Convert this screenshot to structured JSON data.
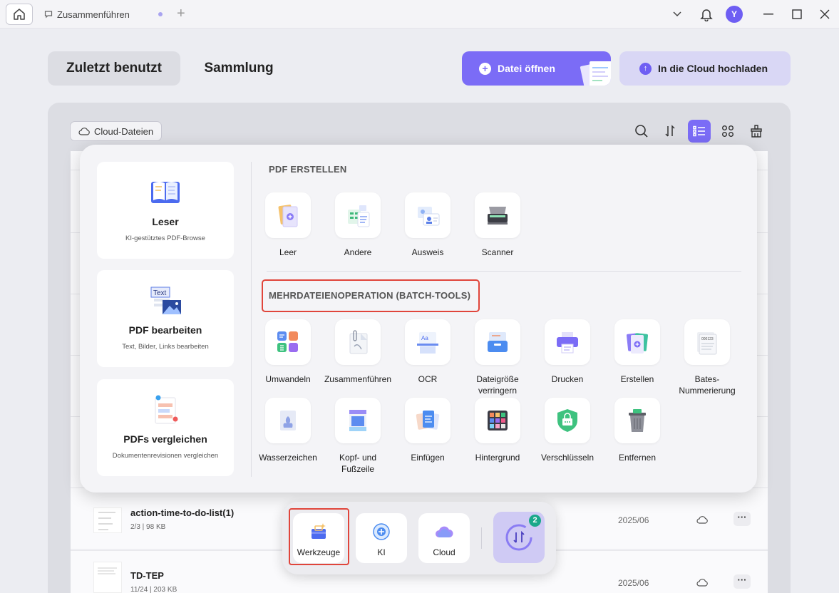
{
  "titlebar": {
    "tab_title": "Zusammenführen",
    "avatar_letter": "Y"
  },
  "nav": {
    "recent": "Zuletzt benutzt",
    "collection": "Sammlung",
    "open_file": "Datei öffnen",
    "upload_cloud": "In die Cloud hochladen"
  },
  "toolbar": {
    "cloud_files": "Cloud-Dateien"
  },
  "popover": {
    "cards": [
      {
        "title": "Leser",
        "subtitle": "KI-gestütztes PDF-Browse",
        "icon": "book-icon"
      },
      {
        "title": "PDF bearbeiten",
        "subtitle": "Text, Bilder, Links bearbeiten",
        "icon": "edit-text-icon"
      },
      {
        "title": "PDFs vergleichen",
        "subtitle": "Dokumentenrevisionen vergleichen",
        "icon": "compare-icon"
      }
    ],
    "create_title": "PDF ERSTELLEN",
    "create_items": [
      {
        "label": "Leer",
        "icon": "blank-page-icon"
      },
      {
        "label": "Andere",
        "icon": "other-formats-icon"
      },
      {
        "label": "Ausweis",
        "icon": "id-card-icon"
      },
      {
        "label": "Scanner",
        "icon": "scanner-icon"
      }
    ],
    "batch_title": "MEHRDATEIENOPERATION (BATCH-TOOLS)",
    "batch_row1": [
      {
        "label": "Umwandeln",
        "icon": "convert-icon"
      },
      {
        "label": "Zusammenführen",
        "icon": "merge-icon"
      },
      {
        "label": "OCR",
        "icon": "ocr-icon"
      },
      {
        "label": "Dateigröße verringern",
        "icon": "compress-icon"
      },
      {
        "label": "Drucken",
        "icon": "print-icon"
      },
      {
        "label": "Erstellen",
        "icon": "create-icon"
      },
      {
        "label": "Bates-Nummerierung",
        "icon": "bates-icon"
      }
    ],
    "batch_row2": [
      {
        "label": "Wasserzeichen",
        "icon": "watermark-icon"
      },
      {
        "label": "Kopf- und Fußzeile",
        "icon": "header-footer-icon"
      },
      {
        "label": "Einfügen",
        "icon": "insert-icon"
      },
      {
        "label": "Hintergrund",
        "icon": "background-icon"
      },
      {
        "label": "Verschlüsseln",
        "icon": "encrypt-icon"
      },
      {
        "label": "Entfernen",
        "icon": "remove-icon"
      }
    ]
  },
  "files": [
    {
      "name": "action-time-to-do-list(1)",
      "meta": "2/3 | 98 KB",
      "date": "2025/06"
    },
    {
      "name": "TD-TEP",
      "meta": "11/24 | 203 KB",
      "date": "2025/06"
    }
  ],
  "dock": {
    "tools": "Werkzeuge",
    "ai": "KI",
    "cloud": "Cloud",
    "badge_count": "2"
  },
  "colors": {
    "accent": "#7b6cf6",
    "highlight": "#e0453b",
    "badge": "#1aa88a"
  }
}
